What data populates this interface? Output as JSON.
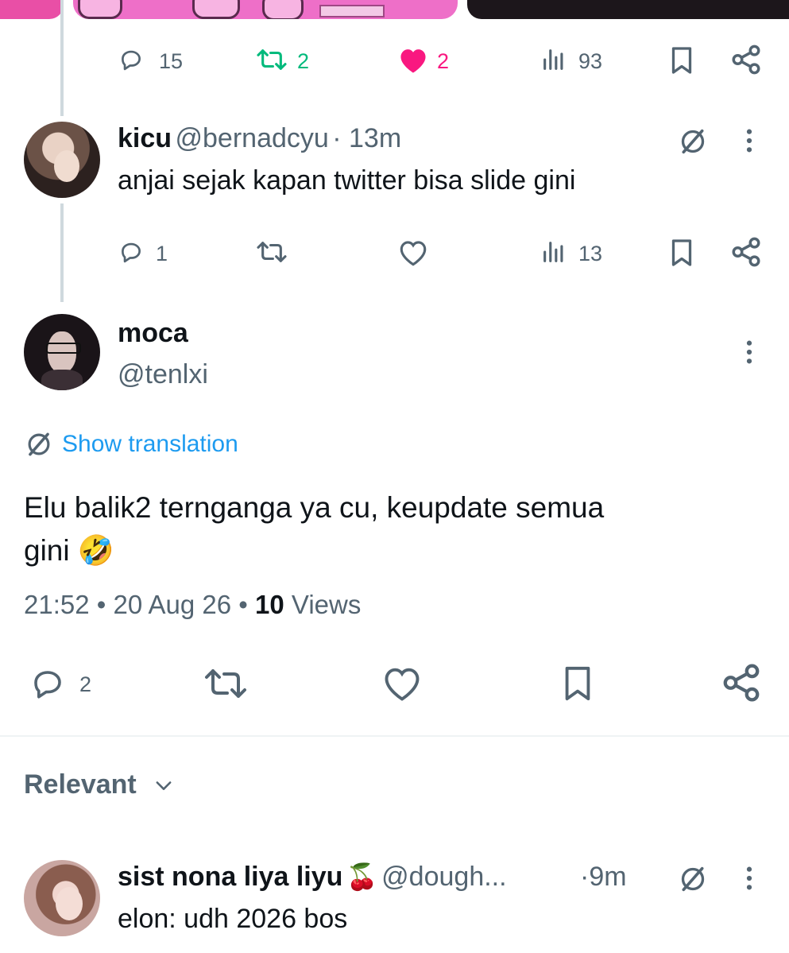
{
  "top_tweet": {
    "actions": {
      "replies": "15",
      "reposts": "2",
      "likes": "2",
      "views": "93"
    }
  },
  "reply_kicu": {
    "name": "kicu",
    "handle": "@bernadcyu",
    "time": "· 13m",
    "text": "anjai sejak kapan twitter bisa slide gini",
    "actions": {
      "replies": "1",
      "views": "13"
    }
  },
  "main_tweet": {
    "name": "moca",
    "handle": "@tenlxi",
    "show_translation": "Show translation",
    "text_line1": "Elu balik2 ternganga ya cu, keupdate semua",
    "text_line2": "gini",
    "emoji": "🤣",
    "time": "21:52",
    "date": "• 20 Aug 26 •",
    "views_count": "10",
    "views_label": "Views",
    "actions": {
      "replies": "2"
    }
  },
  "sort": {
    "label": "Relevant"
  },
  "reply_sist": {
    "name": "sist nona liya liyu",
    "emoji": "🍒",
    "handle": "@dough...",
    "time": "·9m",
    "text": "elon: udh 2026 bos"
  },
  "colors": {
    "accent": "#1d9bf0",
    "repost_green": "#00ba7c",
    "like_pink": "#f91880",
    "secondary_text": "#536471",
    "divider": "#eff3f4"
  },
  "icons": [
    "reply-icon",
    "repost-icon",
    "like-icon",
    "views-icon",
    "bookmark-icon",
    "share-icon",
    "grok-icon",
    "more-icon",
    "translate-icon",
    "chevron-down-icon"
  ]
}
